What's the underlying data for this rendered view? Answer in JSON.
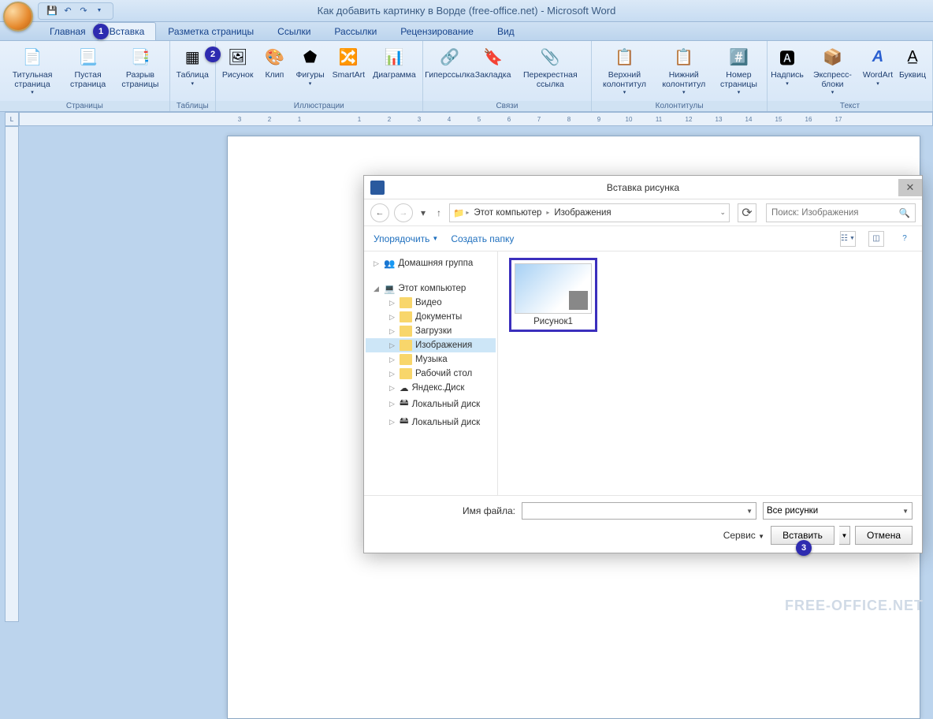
{
  "app": {
    "title": "Как добавить картинку в Ворде (free-office.net) - Microsoft Word"
  },
  "tabs": {
    "home": "Главная",
    "insert": "Вставка",
    "layout": "Разметка страницы",
    "refs": "Ссылки",
    "mail": "Рассылки",
    "review": "Рецензирование",
    "view": "Вид"
  },
  "ribbon": {
    "pages": {
      "label": "Страницы",
      "cover": "Титульная страница",
      "blank": "Пустая страница",
      "break": "Разрыв страницы"
    },
    "tables": {
      "label": "Таблицы",
      "table": "Таблица"
    },
    "illus": {
      "label": "Иллюстрации",
      "picture": "Рисунок",
      "clip": "Клип",
      "shapes": "Фигуры",
      "smartart": "SmartArt",
      "chart": "Диаграмма"
    },
    "links": {
      "label": "Связи",
      "hyperlink": "Гиперссылка",
      "bookmark": "Закладка",
      "crossref": "Перекрестная ссылка"
    },
    "headerfooter": {
      "label": "Колонтитулы",
      "header": "Верхний колонтитул",
      "footer": "Нижний колонтитул",
      "pagenum": "Номер страницы"
    },
    "text": {
      "label": "Текст",
      "textbox": "Надпись",
      "quickparts": "Экспресс-блоки",
      "wordart": "WordArt",
      "dropcap": "Буквиц"
    }
  },
  "ruler": {
    "marks": [
      "3",
      "2",
      "1",
      "",
      "1",
      "2",
      "3",
      "4",
      "5",
      "6",
      "7",
      "8",
      "9",
      "10",
      "11",
      "12",
      "13",
      "14",
      "15",
      "16",
      "17"
    ]
  },
  "dialog": {
    "title": "Вставка рисунка",
    "breadcrumb": {
      "pc": "Этот компьютер",
      "folder": "Изображения"
    },
    "search_placeholder": "Поиск: Изображения",
    "organize": "Упорядочить",
    "newfolder": "Создать папку",
    "tree": {
      "homegroup": "Домашняя группа",
      "thispc": "Этот компьютер",
      "video": "Видео",
      "documents": "Документы",
      "downloads": "Загрузки",
      "images": "Изображения",
      "music": "Музыка",
      "desktop": "Рабочий стол",
      "yadisk": "Яндекс.Диск",
      "localdisk1": "Локальный диск",
      "localdisk2": "Локальный диск"
    },
    "file": {
      "name": "Рисунок1"
    },
    "filename_label": "Имя файла:",
    "filter": "Все рисунки",
    "service": "Сервис",
    "insert": "Вставить",
    "cancel": "Отмена"
  },
  "annotations": {
    "a1": "1",
    "a2": "2",
    "a3": "3"
  },
  "watermark": "FREE-OFFICE.NET"
}
